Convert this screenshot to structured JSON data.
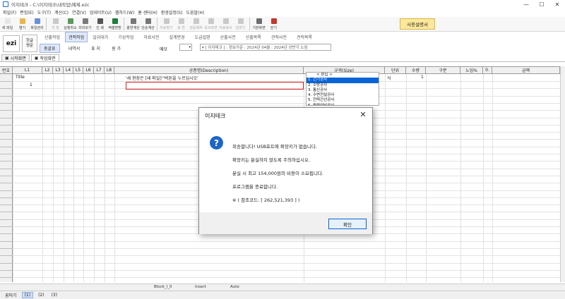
{
  "window": {
    "title": "이지테크 - C:\\이지테크\\내작업\\예제.ezc",
    "minimize": "—",
    "maximize": "☐",
    "close": "✕"
  },
  "menu": [
    "파일(F)",
    "편집(E)",
    "도구(T)",
    "계산(C)",
    "연결(V)",
    "업데이트(U)",
    "웹하드(W)",
    "홈 센터(H)",
    "환경설정(S)",
    "도움말(H)"
  ],
  "toolbar": {
    "buttons": [
      {
        "label": "새 파일",
        "icon": "new-file-icon",
        "color": "#e6e6e6",
        "dim": false
      },
      {
        "label": "열기",
        "icon": "open-folder-icon",
        "color": "#e8b84a",
        "dim": false
      },
      {
        "label": "파일관리",
        "icon": "file-manage-icon",
        "color": "#6b8fd6",
        "dim": false
      },
      {
        "label": "저 장",
        "icon": "save-icon",
        "color": "#c9c9c9",
        "dim": true
      },
      {
        "label": "실행취소",
        "icon": "undo-icon",
        "color": "#5a9a5a",
        "dim": false
      },
      {
        "label": "미리보기",
        "icon": "preview-icon",
        "color": "#7a7a7a",
        "dim": false
      },
      {
        "label": "인 쇄",
        "icon": "print-icon",
        "color": "#555555",
        "dim": false
      },
      {
        "label": "엑셀변환",
        "icon": "excel-icon",
        "color": "#1e7b3c",
        "dim": false
      },
      {
        "label": "총연계산",
        "icon": "sum-icon",
        "color": "#777777",
        "dim": false
      },
      {
        "label": "단순계산",
        "icon": "sigma-icon",
        "color": "#777777",
        "dim": false
      },
      {
        "label": "자료찾기",
        "icon": "search-icon",
        "color": "#c9c9c9",
        "dim": true
      },
      {
        "label": "호 연",
        "icon": "link-icon",
        "color": "#c9c9c9",
        "dim": true
      },
      {
        "label": "엉둥제작",
        "icon": "build-icon",
        "color": "#c9c9c9",
        "dim": true
      },
      {
        "label": "보조화면",
        "icon": "sub-window-icon",
        "color": "#c9c9c9",
        "dim": true
      },
      {
        "label": "자료복사",
        "icon": "copy-icon",
        "color": "#c9c9c9",
        "dim": true
      },
      {
        "label": "입력기",
        "icon": "input-icon",
        "color": "#c9c9c9",
        "dim": true
      },
      {
        "label": "기본화면",
        "icon": "home-screen-icon",
        "color": "#6e6e6e",
        "dim": false
      },
      {
        "label": "닫기",
        "icon": "close-door-icon",
        "color": "#c0392b",
        "dim": false
      }
    ],
    "manual_label": "사용설명서"
  },
  "logo": {
    "text": "ezi"
  },
  "lang_button": {
    "line1": "한글",
    "line2": "명문"
  },
  "tabs": [
    "산출작업",
    "견적작업",
    "일위대가",
    "기성작업",
    "자료사전",
    "설계변경",
    "도급설명",
    "산출사전",
    "산출목록",
    "견적사전",
    "견적목록"
  ],
  "active_tab_index": 1,
  "subrow": {
    "items": [
      "총괄표",
      "내역서",
      "표 지",
      "원 가"
    ],
    "active_index": 0,
    "memo_label": "메모",
    "combo_arrow": "▾",
    "info": "▾ [ 이지테크 ] : 정보가준 : 2024년 04월 : 2024년 상반기 노임"
  },
  "doc_tabs": [
    {
      "label": "시작화면",
      "icon": "start-screen-icon",
      "active": false
    },
    {
      "label": "작업화면",
      "icon": "work-screen-icon",
      "active": true
    }
  ],
  "grid": {
    "headers": [
      "번호",
      "L1",
      "L2",
      "L3",
      "L4",
      "L5",
      "L6",
      "L7",
      "L8",
      "공종명(Description)",
      "규격(Size)",
      "단위",
      "수량",
      "구분",
      "노임%",
      "0.",
      "금액"
    ],
    "row1": {
      "number": "Title",
      "desc": "'새 현장은 [새 파일]'\"버튼을 누르십시오'",
      "unit": "식",
      "qty": "1"
    },
    "row2": {
      "number": "1"
    }
  },
  "size_dropdown": {
    "header": "< 편집 >",
    "items": [
      "1. 건기공사",
      "2. 소방공사",
      "3. 통신공사",
      "4. 수변전설공사",
      "5. 전력간선공사",
      "6. 동력설비공사"
    ],
    "selected_index": 0
  },
  "dialog": {
    "title": "이지테크",
    "close": "✕",
    "icon": "?",
    "lines": [
      "죄송합니다!  USB포트에  확장키가 없습니다.",
      "확장키는 분실하지 않도록 주의하십시오.",
      "분실 시 최고 154,000원의 비용이 소요됩니다.",
      "프로그램을 종료합니다.",
      "※ ( 참조코드:  [ 262,521,393 ] )"
    ],
    "ok_label": "확인"
  },
  "status": {
    "block": "Block_I_0",
    "mode": "Insert",
    "auto": "Auto"
  },
  "bottom": {
    "label": "꿈미기",
    "pages": [
      "(1)",
      "(2)",
      "(3)"
    ],
    "active_index": 0
  }
}
